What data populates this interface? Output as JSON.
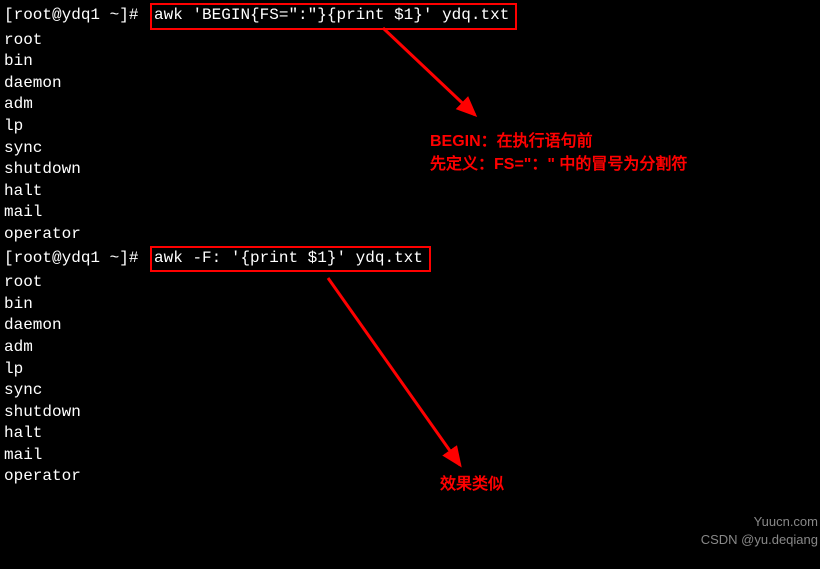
{
  "prompt": "[root@ydq1 ~]# ",
  "command1": "awk 'BEGIN{FS=\":\"}{print $1}' ydq.txt",
  "command2": "awk -F: '{print $1}' ydq.txt",
  "output": [
    "root",
    "bin",
    "daemon",
    "adm",
    "lp",
    "sync",
    "shutdown",
    "halt",
    "mail",
    "operator"
  ],
  "annotations": {
    "top_line1": "BEGIN：在执行语句前",
    "top_line2": "先定义：FS=\"：\" 中的冒号为分割符",
    "bottom": "效果类似"
  },
  "watermarks": {
    "site": "Yuucn.com",
    "credit": "CSDN @yu.deqiang"
  }
}
